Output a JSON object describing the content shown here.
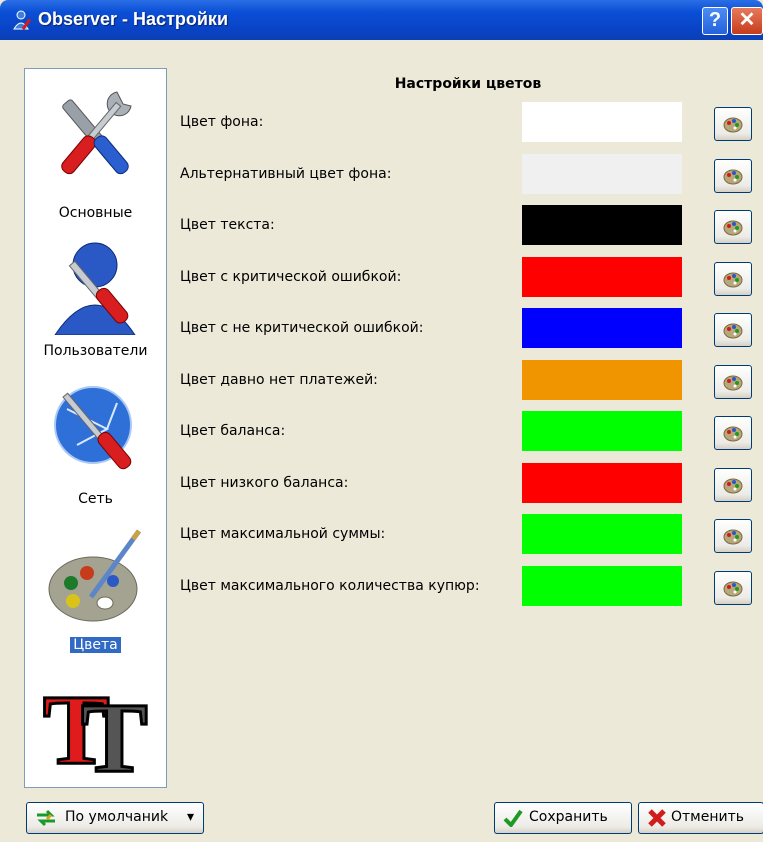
{
  "window": {
    "title": "Observer - Настройки",
    "help_glyph": "?",
    "close_glyph": "✕"
  },
  "sidebar": {
    "items": [
      {
        "label": "Основные",
        "icon": "tools-icon"
      },
      {
        "label": "Пользователи",
        "icon": "user-tools-icon"
      },
      {
        "label": "Сеть",
        "icon": "network-tools-icon"
      },
      {
        "label": "Цвета",
        "icon": "palette-icon",
        "selected": true
      },
      {
        "label": "",
        "icon": "font-icon"
      }
    ]
  },
  "main": {
    "heading": "Настройки цветов",
    "rows": [
      {
        "label": "Цвет фона:",
        "color": "#ffffff"
      },
      {
        "label": "Альтернативный цвет фона:",
        "color": "#f0f0f0"
      },
      {
        "label": "Цвет текста:",
        "color": "#000000"
      },
      {
        "label": "Цвет с критической ошибкой:",
        "color": "#ff0000"
      },
      {
        "label": "Цвет с не критической ошибкой:",
        "color": "#0000ff"
      },
      {
        "label": "Цвет давно нет платежей:",
        "color": "#f09400"
      },
      {
        "label": "Цвет баланса:",
        "color": "#00ff00"
      },
      {
        "label": "Цвет низкого баланса:",
        "color": "#ff0000"
      },
      {
        "label": "Цвет максимальной суммы:",
        "color": "#00ff00"
      },
      {
        "label": "Цвет максимального количества купюр:",
        "color": "#00ff00"
      }
    ]
  },
  "footer": {
    "defaults_label": "По умолчаниk",
    "dropdown_glyph": "▾",
    "save_label": "Сохранить",
    "cancel_label": "Отменить"
  }
}
